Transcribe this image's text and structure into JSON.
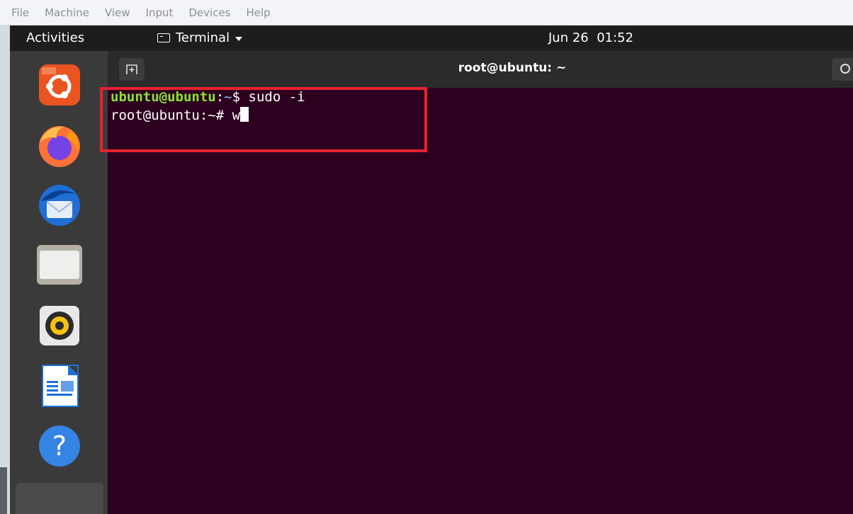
{
  "host_menu": [
    "File",
    "Machine",
    "View",
    "Input",
    "Devices",
    "Help"
  ],
  "topbar": {
    "activities": "Activities",
    "app_name": "Terminal",
    "clock": "Jun 26  01:52"
  },
  "dock": {
    "apps": [
      {
        "name": "Ubuntu Software",
        "icon": "ubuntu-logo-icon"
      },
      {
        "name": "Firefox",
        "icon": "firefox-icon"
      },
      {
        "name": "Thunderbird",
        "icon": "thunderbird-icon"
      },
      {
        "name": "Files",
        "icon": "folder-icon"
      },
      {
        "name": "Rhythmbox",
        "icon": "speaker-icon"
      },
      {
        "name": "LibreOffice Writer",
        "icon": "writer-document-icon"
      },
      {
        "name": "Help",
        "icon": "help-icon"
      }
    ]
  },
  "terminal": {
    "title": "root@ubuntu: ~",
    "lines": [
      {
        "user": "ubuntu@ubuntu",
        "sep": ":",
        "path": "~",
        "prompt": "$ ",
        "command": "sudo -i"
      },
      {
        "prompt_full": "root@ubuntu:~# ",
        "command": "w"
      }
    ]
  },
  "colors": {
    "terminal_bg": "#2c001e",
    "prompt_user": "#8ae234",
    "prompt_path": "#729fcf",
    "highlight_box": "#e8212e"
  }
}
